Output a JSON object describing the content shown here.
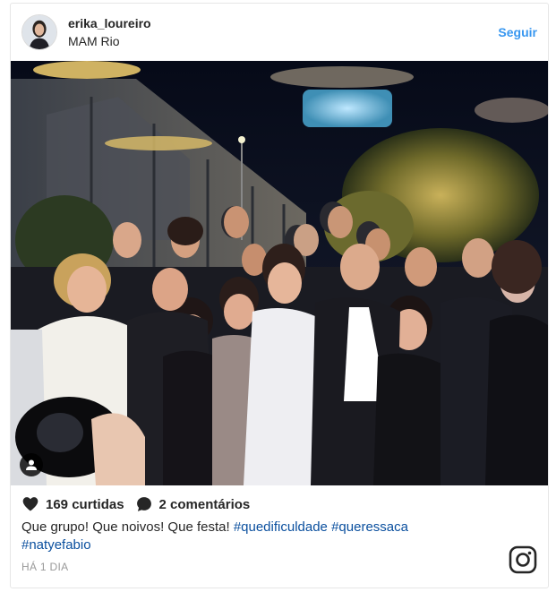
{
  "post": {
    "username": "erika_loureiro",
    "location": "MAM Rio",
    "follow_label": "Seguir",
    "likes": "169 curtidas",
    "comments": "2 comentários",
    "caption_text": "Que grupo! Que noivos! Que festa!",
    "hashtags": [
      "#quedificuldade",
      "#queressaca",
      "#natyefabio"
    ],
    "timestamp": "HÁ 1 DIA"
  },
  "colors": {
    "follow": "#3897f0",
    "hashtag": "#0a4f9e",
    "text": "#262626",
    "muted": "#999999"
  },
  "icons": {
    "like": "heart-icon",
    "comment": "comment-icon",
    "user_tag": "user-tag-icon",
    "brand": "instagram-icon"
  }
}
